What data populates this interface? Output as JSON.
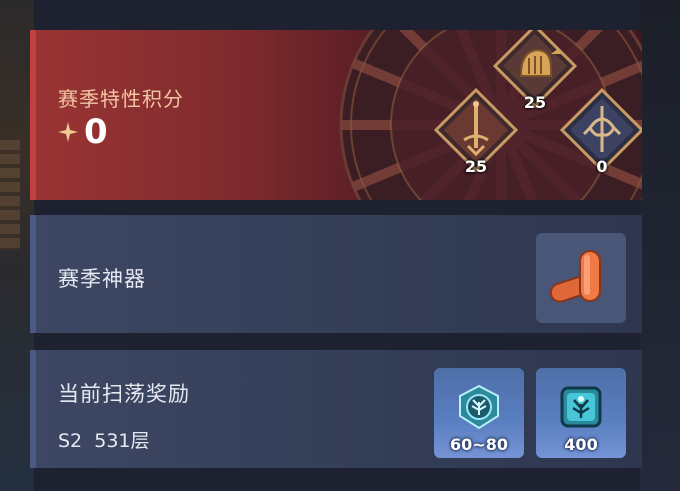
{
  "season_points": {
    "title": "赛季特性积分",
    "value": "0",
    "trait_icons": [
      {
        "icon": "helmet-icon",
        "count": "25"
      },
      {
        "icon": "sword-icon",
        "count": "25"
      },
      {
        "icon": "staff-icon",
        "count": "0"
      }
    ]
  },
  "season_artifact": {
    "title": "赛季神器",
    "item_icon": "bullets-icon"
  },
  "sweep_reward": {
    "title": "当前扫荡奖励",
    "progress": "S2  531层",
    "rewards": [
      {
        "icon": "tree-emblem-icon",
        "count": "60~80"
      },
      {
        "icon": "crystal-tree-icon",
        "count": "400"
      }
    ]
  },
  "colors": {
    "score_panel": "#9a3434",
    "info_panel": "#3d4763",
    "reward_slot": "#5a7fc0"
  }
}
